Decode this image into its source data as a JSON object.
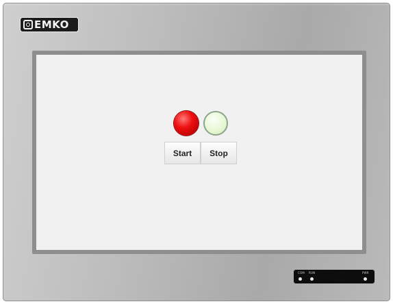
{
  "brand": {
    "logo_text": "EMKO",
    "logo_icon": "emko-mark-icon"
  },
  "hmi": {
    "indicators": [
      {
        "name": "red-indicator-lamp",
        "state": "on",
        "color": "#e81010"
      },
      {
        "name": "green-indicator-lamp",
        "state": "off",
        "color": "#dff5cf"
      }
    ],
    "buttons": {
      "start_label": "Start",
      "stop_label": "Stop"
    }
  },
  "status_leds": {
    "labels": [
      "COM",
      "RUN",
      "PWR"
    ]
  }
}
